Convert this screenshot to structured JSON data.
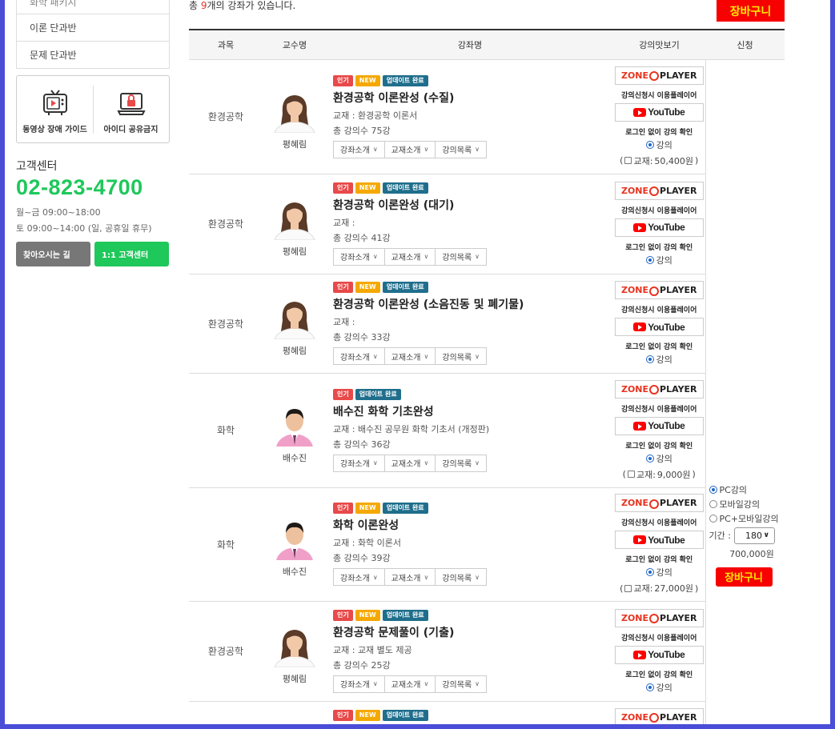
{
  "sidebar": {
    "items": [
      {
        "label": "화학 패키지"
      },
      {
        "label": "이론 단과반"
      },
      {
        "label": "문제 단과반"
      }
    ],
    "quick_links": [
      {
        "label": "동영상 장애 가이드",
        "icon": "tv-icon"
      },
      {
        "label": "아이디 공유금지",
        "icon": "lock-laptop-icon"
      }
    ],
    "cs_title": "고객센터",
    "cs_phone": "02-823-4700",
    "cs_hours_1": "월~금 09:00~18:00",
    "cs_hours_2": "토 09:00~14:00 (일, 공휴일 휴무)",
    "btn_directions": "찾아오시는 길",
    "btn_support": "1:1 고객센터"
  },
  "main": {
    "count_pre": "총 ",
    "count_num": "9",
    "count_post": "개의 강좌가 있습니다.",
    "cart_label": "장바구니",
    "headers": {
      "subject": "과목",
      "professor": "교수명",
      "course": "강좌명",
      "preview": "강의맛보기",
      "apply": "신청"
    },
    "dropdowns": {
      "intro": "강좌소개",
      "textbook": "교재소개",
      "list": "강의목록"
    },
    "preview": {
      "zone_player": "ZONE PLAYER",
      "player_note": "강의신청시 이용플레이어",
      "youtube": "YouTube",
      "youtube_note": "로그인 없이 강의 확인",
      "lecture_radio": "강의",
      "textbook_prefix": "교재:"
    },
    "badges": {
      "hot": "인기",
      "new": "NEW",
      "updated": "업데이트 완료"
    },
    "rows": [
      {
        "subject": "환경공학",
        "professor": "평혜림",
        "title": "환경공학 이론완성 (수질)",
        "textbook": "교재 : 환경공학 이론서",
        "lectures": "총 강의수 75강",
        "book_price": "50,400원",
        "has_new": true
      },
      {
        "subject": "환경공학",
        "professor": "평혜림",
        "title": "환경공학 이론완성 (대기)",
        "textbook": "교재 :",
        "lectures": "총 강의수 41강",
        "book_price": "",
        "has_new": true
      },
      {
        "subject": "환경공학",
        "professor": "평혜림",
        "title": "환경공학 이론완성 (소음진동 및 폐기물)",
        "textbook": "교재 :",
        "lectures": "총 강의수 33강",
        "book_price": "",
        "has_new": true
      },
      {
        "subject": "화학",
        "professor": "배수진",
        "title": "배수진 화학 기초완성",
        "textbook": "교재 : 배수진 공무원 화학 기초서 (개정판)",
        "lectures": "총 강의수 36강",
        "book_price": "9,000원",
        "has_new": false
      },
      {
        "subject": "화학",
        "professor": "배수진",
        "title": "화학 이론완성",
        "textbook": "교재 : 화학 이론서",
        "lectures": "총 강의수 39강",
        "book_price": "27,000원",
        "has_new": true
      },
      {
        "subject": "환경공학",
        "professor": "평혜림",
        "title": "환경공학 문제풀이 (기출)",
        "textbook": "교재 : 교재 별도 제공",
        "lectures": "총 강의수 25강",
        "book_price": "",
        "has_new": true
      },
      {
        "subject": "",
        "professor": "",
        "title": "",
        "textbook": "",
        "lectures": "",
        "book_price": "",
        "has_new": true
      }
    ],
    "apply": {
      "opt_pc": "PC강의",
      "opt_mobile": "모바일강의",
      "opt_both": "PC+모바일강의",
      "period_label": "기간 :",
      "period_value": "180",
      "price": "700,000원",
      "cart_label": "장바구니"
    }
  }
}
